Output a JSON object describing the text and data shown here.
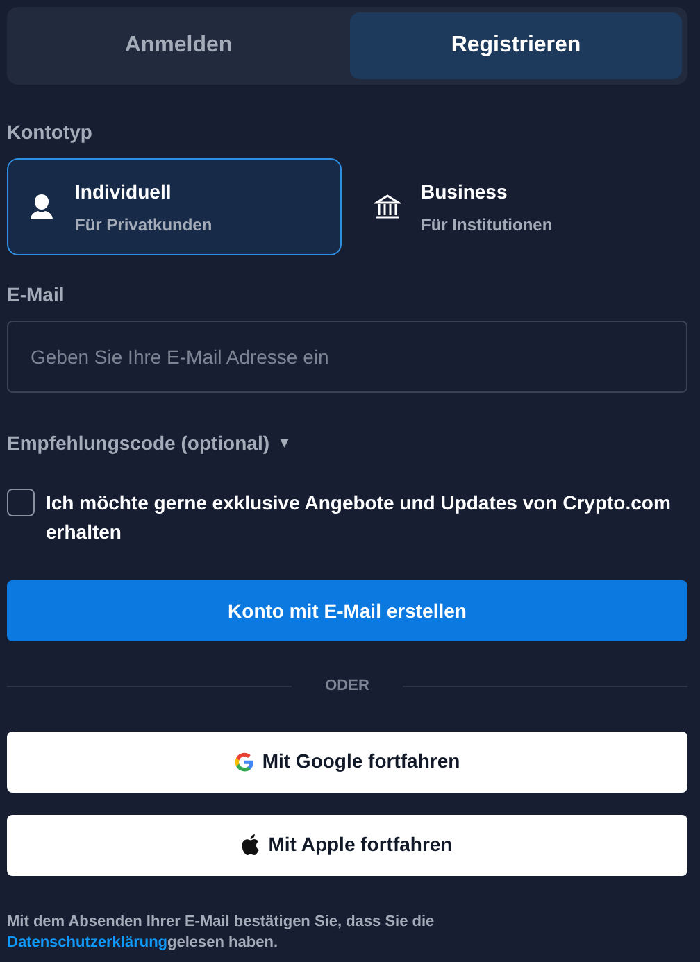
{
  "tabs": [
    {
      "label": "Anmelden",
      "selected": false
    },
    {
      "label": "Registrieren",
      "selected": true
    }
  ],
  "account_type": {
    "label": "Kontotyp",
    "options": [
      {
        "kind": "person",
        "title": "Individuell",
        "subtitle": "Für Privatkunden",
        "selected": true
      },
      {
        "kind": "bank",
        "title": "Business",
        "subtitle": "Für Institutionen",
        "selected": false
      }
    ]
  },
  "email": {
    "label": "E-Mail",
    "placeholder": "Geben Sie Ihre E-Mail Adresse ein"
  },
  "referral": {
    "label": "Empfehlungscode (optional)",
    "caret": "▾"
  },
  "consent": {
    "label": "Ich möchte gerne exklusive Angebote und Updates von Crypto.com erhalten",
    "checked": false
  },
  "primary_button": "Konto mit E-Mail erstellen",
  "divider": "ODER",
  "social_buttons": [
    {
      "kind": "google",
      "label": "Mit Google fortfahren"
    },
    {
      "kind": "apple",
      "label": "Mit Apple fortfahren"
    }
  ],
  "footer": {
    "before": "Mit dem Absenden Ihrer E-Mail bestätigen Sie, dass Sie die ",
    "link": "Datenschutzerklärung",
    "after": "gelesen haben."
  }
}
